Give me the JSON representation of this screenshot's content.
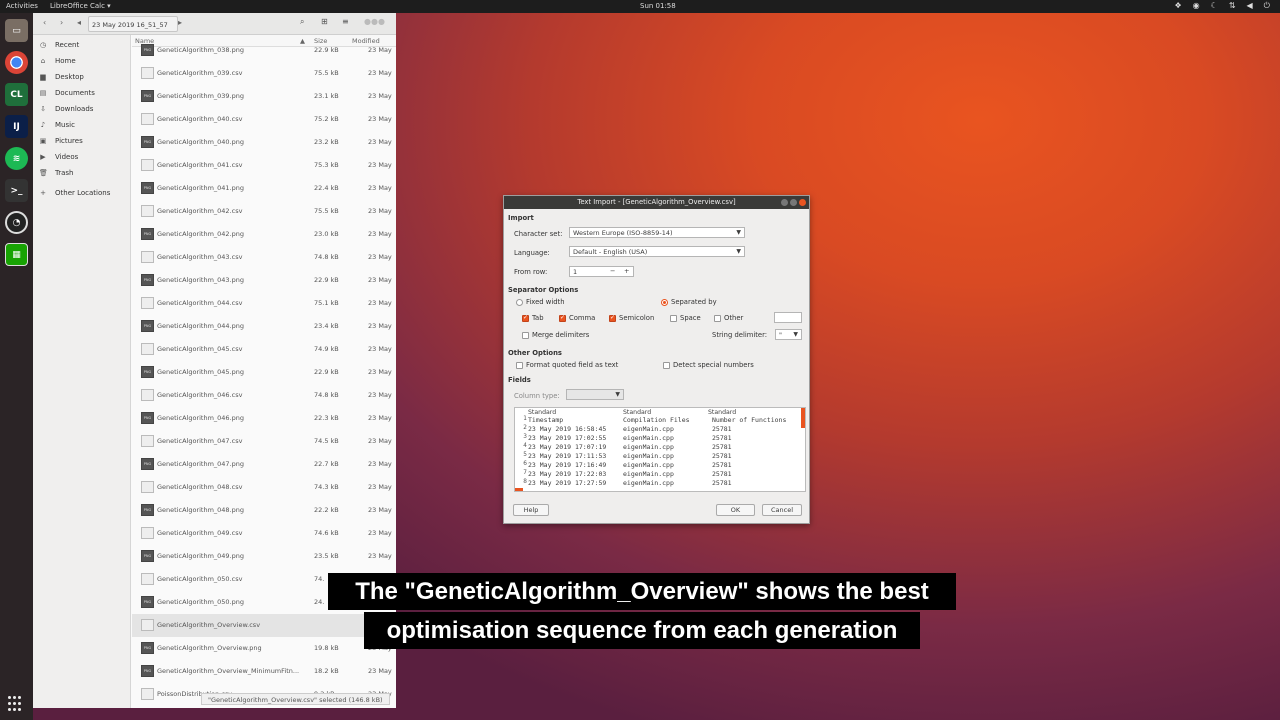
{
  "topbar": {
    "activities": "Activities",
    "app_menu": "LibreOffice Calc ▾",
    "clock": "Sun 01:58",
    "tray_icons": [
      "dropbox-icon",
      "chrome-status-icon",
      "night-light-icon",
      "network-icon",
      "volume-icon",
      "power-icon"
    ]
  },
  "dock": {
    "items": [
      "files-icon",
      "chrome-icon",
      "clion-icon",
      "intellij-icon",
      "spotify-icon",
      "terminal-icon",
      "obs-icon",
      "libreoffice-calc-icon"
    ],
    "clion_label": "CL",
    "intellij_label": "IJ"
  },
  "files": {
    "path_button": "23 May 2019 16_51_57",
    "sidebar": [
      "Recent",
      "Home",
      "Desktop",
      "Documents",
      "Downloads",
      "Music",
      "Pictures",
      "Videos",
      "Trash",
      "Other Locations"
    ],
    "columns": {
      "name": "Name",
      "size": "Size",
      "modified": "Modified"
    },
    "rows": [
      {
        "name": "GeneticAlgorithm_038.png",
        "size": "22.9 kB",
        "date": "23 May",
        "type": "png"
      },
      {
        "name": "GeneticAlgorithm_039.csv",
        "size": "75.5 kB",
        "date": "23 May",
        "type": "csv"
      },
      {
        "name": "GeneticAlgorithm_039.png",
        "size": "23.1 kB",
        "date": "23 May",
        "type": "png"
      },
      {
        "name": "GeneticAlgorithm_040.csv",
        "size": "75.2 kB",
        "date": "23 May",
        "type": "csv"
      },
      {
        "name": "GeneticAlgorithm_040.png",
        "size": "23.2 kB",
        "date": "23 May",
        "type": "png"
      },
      {
        "name": "GeneticAlgorithm_041.csv",
        "size": "75.3 kB",
        "date": "23 May",
        "type": "csv"
      },
      {
        "name": "GeneticAlgorithm_041.png",
        "size": "22.4 kB",
        "date": "23 May",
        "type": "png"
      },
      {
        "name": "GeneticAlgorithm_042.csv",
        "size": "75.5 kB",
        "date": "23 May",
        "type": "csv"
      },
      {
        "name": "GeneticAlgorithm_042.png",
        "size": "23.0 kB",
        "date": "23 May",
        "type": "png"
      },
      {
        "name": "GeneticAlgorithm_043.csv",
        "size": "74.8 kB",
        "date": "23 May",
        "type": "csv"
      },
      {
        "name": "GeneticAlgorithm_043.png",
        "size": "22.9 kB",
        "date": "23 May",
        "type": "png"
      },
      {
        "name": "GeneticAlgorithm_044.csv",
        "size": "75.1 kB",
        "date": "23 May",
        "type": "csv"
      },
      {
        "name": "GeneticAlgorithm_044.png",
        "size": "23.4 kB",
        "date": "23 May",
        "type": "png"
      },
      {
        "name": "GeneticAlgorithm_045.csv",
        "size": "74.9 kB",
        "date": "23 May",
        "type": "csv"
      },
      {
        "name": "GeneticAlgorithm_045.png",
        "size": "22.9 kB",
        "date": "23 May",
        "type": "png"
      },
      {
        "name": "GeneticAlgorithm_046.csv",
        "size": "74.8 kB",
        "date": "23 May",
        "type": "csv"
      },
      {
        "name": "GeneticAlgorithm_046.png",
        "size": "22.3 kB",
        "date": "23 May",
        "type": "png"
      },
      {
        "name": "GeneticAlgorithm_047.csv",
        "size": "74.5 kB",
        "date": "23 May",
        "type": "csv"
      },
      {
        "name": "GeneticAlgorithm_047.png",
        "size": "22.7 kB",
        "date": "23 May",
        "type": "png"
      },
      {
        "name": "GeneticAlgorithm_048.csv",
        "size": "74.3 kB",
        "date": "23 May",
        "type": "csv"
      },
      {
        "name": "GeneticAlgorithm_048.png",
        "size": "22.2 kB",
        "date": "23 May",
        "type": "png"
      },
      {
        "name": "GeneticAlgorithm_049.csv",
        "size": "74.6 kB",
        "date": "23 May",
        "type": "csv"
      },
      {
        "name": "GeneticAlgorithm_049.png",
        "size": "23.5 kB",
        "date": "23 May",
        "type": "png"
      },
      {
        "name": "GeneticAlgorithm_050.csv",
        "size": "74.",
        "date": "23 May",
        "type": "csv"
      },
      {
        "name": "GeneticAlgorithm_050.png",
        "size": "24.",
        "date": "23 May",
        "type": "png"
      },
      {
        "name": "GeneticAlgorithm_Overview.csv",
        "size": "",
        "date": "23 May",
        "type": "csv",
        "selected": true
      },
      {
        "name": "GeneticAlgorithm_Overview.png",
        "size": "19.8 kB",
        "date": "23 May",
        "type": "png"
      },
      {
        "name": "GeneticAlgorithm_Overview_MinimumFitn...",
        "size": "18.2 kB",
        "date": "23 May",
        "type": "png"
      },
      {
        "name": "PoissonDistribution.csv",
        "size": "9.2 kB",
        "date": "23 May",
        "type": "csv"
      }
    ],
    "status": "\"GeneticAlgorithm_Overview.csv\" selected (146.8 kB)"
  },
  "dialog": {
    "title": "Text Import - [GeneticAlgorithm_Overview.csv]",
    "import_section": "Import",
    "charset_label": "Character set:",
    "charset_value": "Western Europe (ISO-8859-14)",
    "language_label": "Language:",
    "language_value": "Default - English (USA)",
    "fromrow_label": "From row:",
    "fromrow_value": "1",
    "fromrow_minus": "−",
    "fromrow_plus": "+",
    "separator_section": "Separator Options",
    "fixed_width": "Fixed width",
    "separated_by": "Separated by",
    "tab": "Tab",
    "comma": "Comma",
    "semicolon": "Semicolon",
    "space": "Space",
    "other": "Other",
    "merge_delimiters": "Merge delimiters",
    "string_delimiter_label": "String delimiter:",
    "string_delimiter_value": "\"",
    "other_section": "Other Options",
    "format_quoted": "Format quoted field as text",
    "detect_special": "Detect special numbers",
    "fields_section": "Fields",
    "column_type_label": "Column type:",
    "preview_headers": [
      "Standard",
      "Standard",
      "Standard"
    ],
    "preview_rows": [
      {
        "n": "1",
        "c1": "Timestamp",
        "c2": "Compilation Files",
        "c3": "Number of Functions"
      },
      {
        "n": "2",
        "c1": "23 May 2019 16:58:45",
        "c2": "eigenMain.cpp",
        "c3": "25781"
      },
      {
        "n": "3",
        "c1": "23 May 2019 17:02:55",
        "c2": "eigenMain.cpp",
        "c3": "25781"
      },
      {
        "n": "4",
        "c1": "23 May 2019 17:07:19",
        "c2": "eigenMain.cpp",
        "c3": "25781"
      },
      {
        "n": "5",
        "c1": "23 May 2019 17:11:53",
        "c2": "eigenMain.cpp",
        "c3": "25781"
      },
      {
        "n": "6",
        "c1": "23 May 2019 17:16:49",
        "c2": "eigenMain.cpp",
        "c3": "25781"
      },
      {
        "n": "7",
        "c1": "23 May 2019 17:22:03",
        "c2": "eigenMain.cpp",
        "c3": "25781"
      },
      {
        "n": "8",
        "c1": "23 May 2019 17:27:59",
        "c2": "eigenMain.cpp",
        "c3": "25781"
      }
    ],
    "help": "Help",
    "ok": "OK",
    "cancel": "Cancel"
  },
  "caption": {
    "line1": "The \"GeneticAlgorithm_Overview\" shows the best",
    "line2": "optimisation sequence  from each generation"
  },
  "colors": {
    "accent": "#e95420",
    "panel": "#1d1d1d"
  }
}
